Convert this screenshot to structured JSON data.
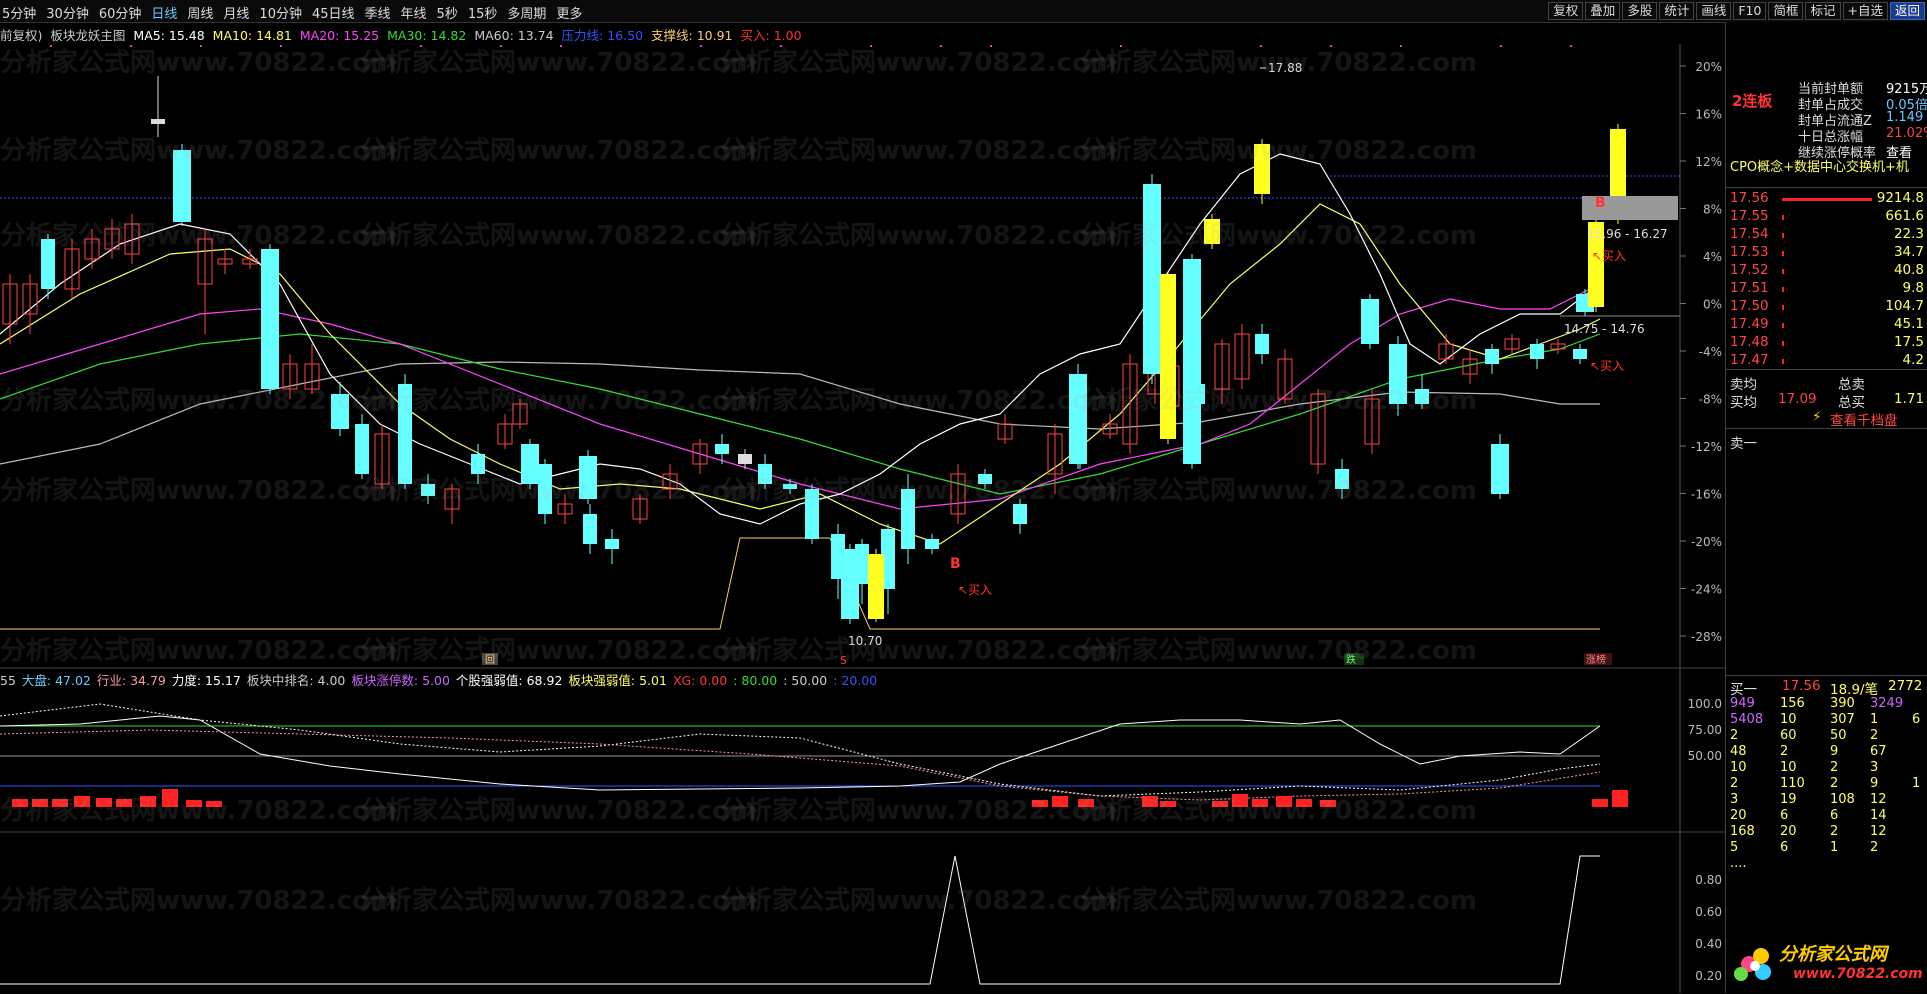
{
  "toolbar": {
    "periods": [
      "5分钟",
      "30分钟",
      "60分钟",
      "日线",
      "周线",
      "月线",
      "10分钟",
      "45日线",
      "季线",
      "年线",
      "5秒",
      "15秒",
      "多周期",
      "更多"
    ],
    "active_period": "日线",
    "right_buttons": [
      "复权",
      "叠加",
      "多股",
      "统计",
      "画线",
      "F10",
      "简框",
      "标记",
      "+自选",
      "返回"
    ]
  },
  "main_header": {
    "items": [
      {
        "text": "前复权)",
        "color": "#cccccc"
      },
      {
        "text": "板块龙妖主图",
        "color": "#cccccc"
      },
      {
        "text": "MA5: 15.48",
        "color": "#ffffff"
      },
      {
        "text": "MA10: 14.81",
        "color": "#ffff66"
      },
      {
        "text": "MA20: 15.25",
        "color": "#ff44ff"
      },
      {
        "text": "MA30: 14.82",
        "color": "#33dd33"
      },
      {
        "text": "MA60: 13.74",
        "color": "#cccccc"
      },
      {
        "text": "压力线: 16.50",
        "color": "#3355ff"
      },
      {
        "text": "支撑线: 10.91",
        "color": "#ffcc66"
      },
      {
        "text": "买入: 1.00",
        "color": "#ff3333"
      }
    ]
  },
  "price_axis": [
    "20%",
    "16%",
    "12%",
    "8%",
    "4%",
    "0%",
    "-4%",
    "-8%",
    "-12%",
    "-16%",
    "-20%",
    "-24%",
    "-28%"
  ],
  "annotations": {
    "high_label": "17.88",
    "low_label": "10.70",
    "range_label_1": "15.96 - 16.27",
    "range_label_2": "14.75 - 14.76",
    "buy_label": "买入",
    "b_marker": "B",
    "s_marker": "S",
    "badge_huibu": "回",
    "badge_die": "跌",
    "badge_zhangting": "涨榜"
  },
  "ind1_header": {
    "items": [
      {
        "text": "55",
        "color": "#cccccc"
      },
      {
        "text": "大盘: 47.02",
        "color": "#66ccff"
      },
      {
        "text": "行业: 34.79",
        "color": "#ff9999"
      },
      {
        "text": "力度: 15.17",
        "color": "#ffffff"
      },
      {
        "text": "板块中排名: 4.00",
        "color": "#cccccc"
      },
      {
        "text": "板块涨停数: 5.00",
        "color": "#cc66ff"
      },
      {
        "text": "个股强弱值: 68.92",
        "color": "#ffffff"
      },
      {
        "text": "板块强弱值: 5.01",
        "color": "#ffff66"
      },
      {
        "text": "XG: 0.00",
        "color": "#ff3333"
      },
      {
        "text": ": 80.00",
        "color": "#33dd33"
      },
      {
        "text": ": 50.00",
        "color": "#cccccc"
      },
      {
        "text": ": 20.00",
        "color": "#3355ff"
      }
    ]
  },
  "ind1_axis": [
    "100.0",
    "75.00",
    "50.00"
  ],
  "ind2_axis": [
    "0.80",
    "0.60",
    "0.40",
    "0.20"
  ],
  "watermark": "分析家公式网www.70822.com",
  "right_panel": {
    "board_tag": "2连板",
    "stats": [
      {
        "label": "当前封单额",
        "value": "9215万",
        "color": "#ffffff"
      },
      {
        "label": "封单占成交",
        "value": "0.05倍",
        "color": "#66ccff"
      },
      {
        "label": "封单占流通Z",
        "value": "1.149",
        "color": "#66ccff"
      },
      {
        "label": "十日总涨幅",
        "value": "21.02%",
        "color": "#ff4444"
      },
      {
        "label": "继续涨停概率",
        "value": "查看",
        "color": "#ffffff"
      }
    ],
    "concept": "CPO概念+数据中心交换机+机",
    "sell_book": [
      {
        "price": "17.56",
        "vol": "9214.8"
      },
      {
        "price": "17.55",
        "vol": "661.6"
      },
      {
        "price": "17.54",
        "vol": "22.3"
      },
      {
        "price": "17.53",
        "vol": "34.7"
      },
      {
        "price": "17.52",
        "vol": "40.8"
      },
      {
        "price": "17.51",
        "vol": "9.8"
      },
      {
        "price": "17.50",
        "vol": "104.7"
      },
      {
        "price": "17.49",
        "vol": "45.1"
      },
      {
        "price": "17.48",
        "vol": "17.5"
      },
      {
        "price": "17.47",
        "vol": "4.2"
      }
    ],
    "sell_avg_label": "卖均",
    "total_sell_label": "总卖",
    "buy_avg_label": "买均",
    "buy_avg_value": "17.09",
    "total_buy_label": "总买",
    "total_buy_value": "1.71",
    "qianjue_label": "查看千档盘",
    "sell1_label": "卖一",
    "buy1": {
      "label": "买一",
      "price": "17.56",
      "orders": "18.9/笔",
      "count": "2772"
    },
    "queue": [
      [
        "949",
        "156",
        "390",
        "3249"
      ],
      [
        "5408",
        "10",
        "307",
        "1",
        "6"
      ],
      [
        "2",
        "60",
        "50",
        "2"
      ],
      [
        "48",
        "2",
        "9",
        "67"
      ],
      [
        "10",
        "10",
        "2",
        "3"
      ],
      [
        "2",
        "110",
        "2",
        "9",
        "1"
      ],
      [
        "3",
        "19",
        "108",
        "12"
      ],
      [
        "20",
        "6",
        "6",
        "14"
      ],
      [
        "168",
        "20",
        "2",
        "12"
      ],
      [
        "5",
        "6",
        "1",
        "2"
      ],
      [
        "...."
      ]
    ],
    "logo_text": "分析家公式网",
    "logo_url": "www.70822.com"
  }
}
